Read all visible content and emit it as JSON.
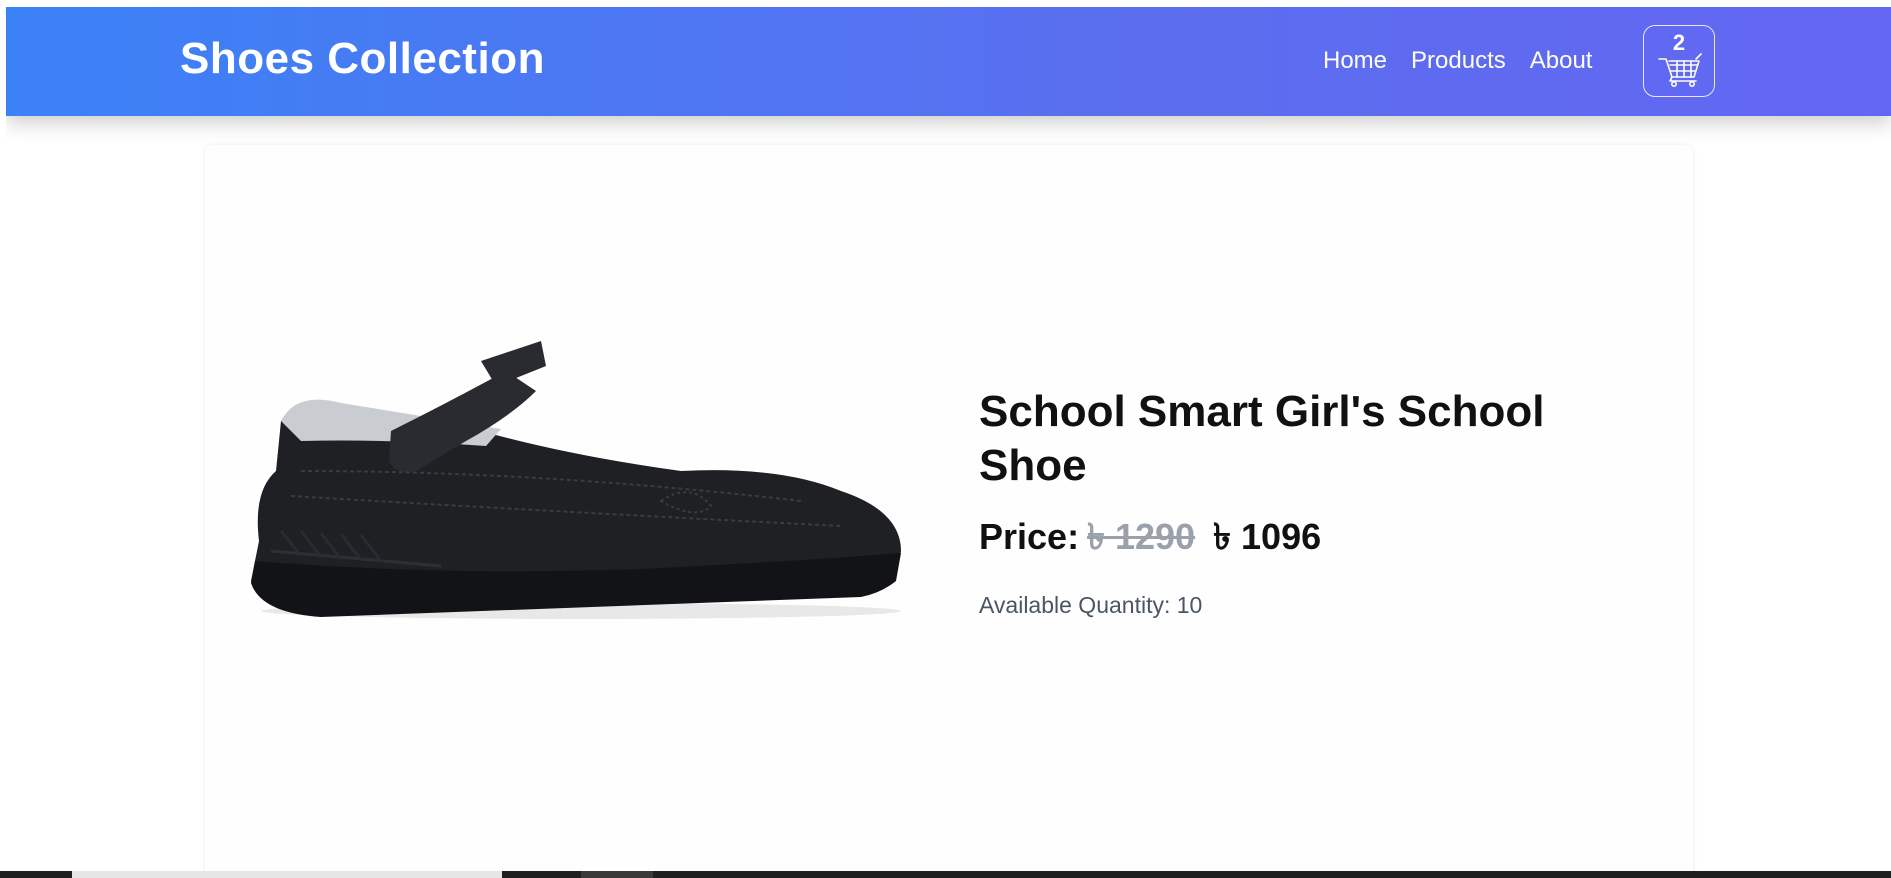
{
  "navbar": {
    "brand": "Shoes Collection",
    "links": [
      {
        "label": "Home"
      },
      {
        "label": "Products"
      },
      {
        "label": "About"
      }
    ],
    "cart": {
      "count": "2",
      "icon": "cart-icon"
    },
    "colors": {
      "gradient_start": "#3b82f6",
      "gradient_end": "#6366f1"
    }
  },
  "product": {
    "image_icon": "shoe-image",
    "title": "School Smart Girl's School Shoe",
    "price_label": "Price:",
    "old_price": "৳ 1290",
    "new_price": "৳ 1096",
    "quantity_text": "Available Quantity: 10"
  }
}
